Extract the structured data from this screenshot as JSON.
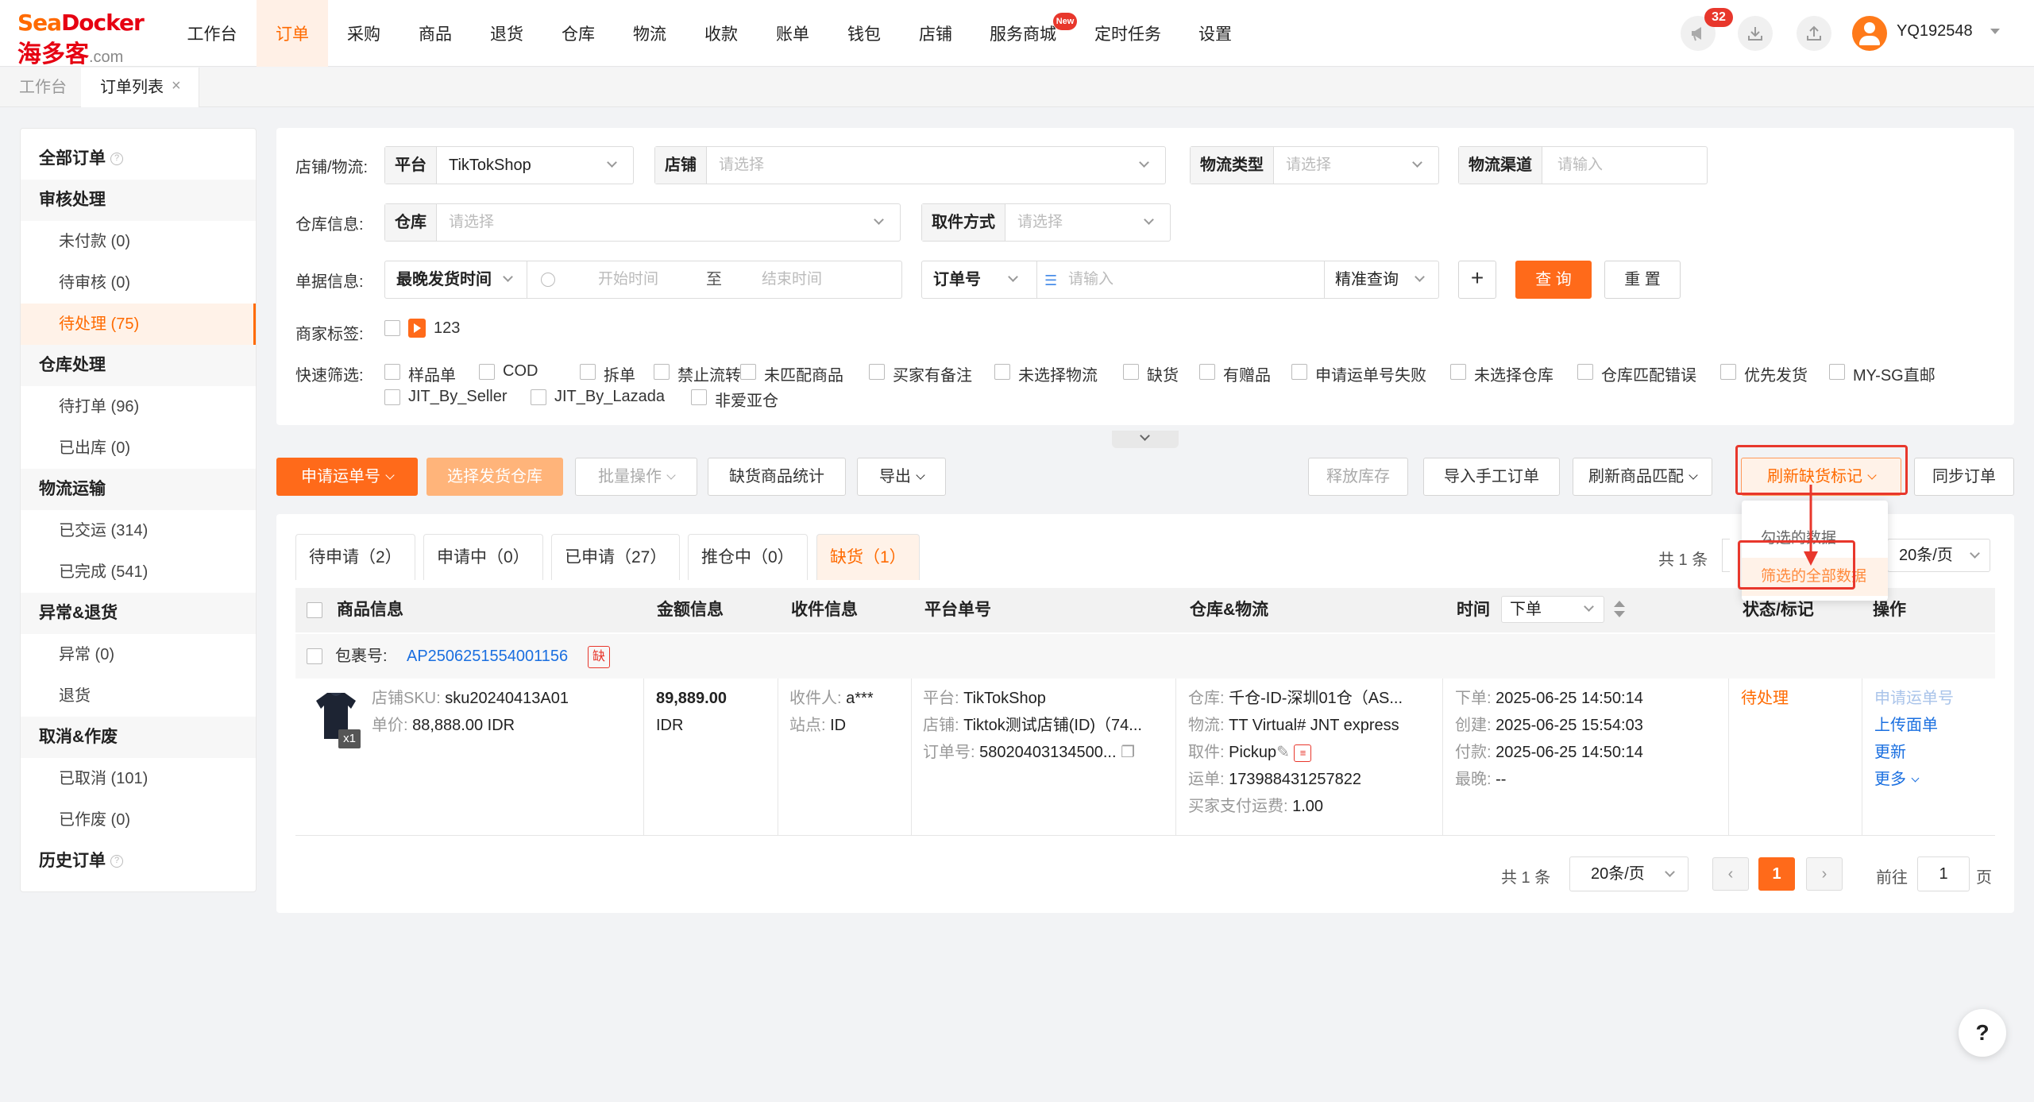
{
  "brand": {
    "name_en_a": "Sea",
    "name_en_b": "Docker",
    "name_cn": "海多客",
    "domain": ".com"
  },
  "topnav": {
    "items": [
      "工作台",
      "订单",
      "采购",
      "商品",
      "退货",
      "仓库",
      "物流",
      "收款",
      "账单",
      "钱包",
      "店铺",
      "服务商城",
      "定时任务",
      "设置"
    ],
    "active_index": 1,
    "service_badge": "New",
    "notification_count": "32",
    "username": "YQ192548"
  },
  "tabs": [
    "工作台",
    "订单列表"
  ],
  "sidebar": {
    "all_orders": "全部订单",
    "history": "历史订单",
    "groups": [
      {
        "title": "审核处理",
        "items": [
          "未付款 (0)",
          "待审核 (0)",
          "待处理 (75)"
        ]
      },
      {
        "title": "仓库处理",
        "items": [
          "待打单 (96)",
          "已出库 (0)"
        ]
      },
      {
        "title": "物流运输",
        "items": [
          "已交运 (314)",
          "已完成 (541)"
        ]
      },
      {
        "title": "异常&退货",
        "items": [
          "异常 (0)",
          "退货"
        ]
      },
      {
        "title": "取消&作废",
        "items": [
          "已取消 (101)",
          "已作废 (0)"
        ]
      }
    ]
  },
  "filter": {
    "store_logistics_label": "店铺/物流:",
    "platform_label": "平台",
    "platform_value": "TikTokShop",
    "store_label": "店铺",
    "store_ph": "请选择",
    "logistics_type_label": "物流类型",
    "logistics_type_ph": "请选择",
    "logistics_channel_label": "物流渠道",
    "logistics_channel_ph": "请输入",
    "warehouse_info_label": "仓库信息:",
    "warehouse_label": "仓库",
    "warehouse_ph": "请选择",
    "pickup_label": "取件方式",
    "pickup_ph": "请选择",
    "doc_info_label": "单据信息:",
    "time_select": "最晚发货时间",
    "start_ph": "开始时间",
    "to": "至",
    "end_ph": "结束时间",
    "order_no_select": "订单号",
    "order_no_ph": "请输入",
    "exact_select": "精准查询",
    "add": "+",
    "query": "查 询",
    "reset": "重 置",
    "merchant_tag_label": "商家标签:",
    "merchant_tag": "123",
    "quick_label": "快速筛选:",
    "quick_row1": [
      "样品单",
      "COD",
      "拆单",
      "禁止流转",
      "未匹配商品",
      "买家有备注",
      "未选择物流",
      "缺货",
      "有赠品",
      "申请运单号失败",
      "未选择仓库",
      "仓库匹配错误",
      "优先发货",
      "MY-SG直邮"
    ],
    "quick_row2": [
      "JIT_By_Seller",
      "JIT_By_Lazada",
      "非爱亚仓"
    ]
  },
  "actions": {
    "apply_waybill": "申请运单号",
    "select_warehouse": "选择发货仓库",
    "batch": "批量操作",
    "stockout_stats": "缺货商品统计",
    "export": "导出",
    "release_stock": "释放库存",
    "import_manual": "导入手工订单",
    "refresh_match": "刷新商品匹配",
    "refresh_stockout": "刷新缺货标记",
    "sync": "同步订单"
  },
  "dropdown": {
    "items": [
      "勾选的数据",
      "筛选的全部数据"
    ]
  },
  "status_tabs": [
    "待申请（2）",
    "申请中（0）",
    "已申请（27）",
    "推仓中（0）",
    "缺货（1）"
  ],
  "status_active": 4,
  "list_meta": {
    "total": "共 1 条",
    "page_size": "20条/页"
  },
  "table": {
    "headers": [
      "商品信息",
      "金额信息",
      "收件信息",
      "平台单号",
      "仓库&物流",
      "时间",
      "状态/标记",
      "操作"
    ],
    "time_select": "下单",
    "package_label": "包裹号:",
    "package_no": "AP2506251554001156",
    "package_tag": "缺",
    "row": {
      "sku_label": "店铺SKU:",
      "sku": "sku20240413A01",
      "unit_label": "单价:",
      "unit": "88,888.00 IDR",
      "qty": "x1",
      "amount": "89,889.00",
      "currency": "IDR",
      "receiver_label": "收件人:",
      "receiver": "a***",
      "site_label": "站点:",
      "site": "ID",
      "platform_label": "平台:",
      "platform": "TikTokShop",
      "store_label": "店铺:",
      "store": "Tiktok测试店铺(ID)（74...",
      "orderno_label": "订单号:",
      "orderno": "58020403134500...",
      "wh_label": "仓库:",
      "wh": "千仓-ID-深圳01仓（AS...",
      "log_label": "物流:",
      "log": "TT Virtual# JNT express",
      "pick_label": "取件:",
      "pick": "Pickup",
      "waybill_label": "运单:",
      "waybill": "173988431257822",
      "fee_label": "买家支付运费:",
      "fee": "1.00",
      "t_order_label": "下单:",
      "t_order": "2025-06-25 14:50:14",
      "t_create_label": "创建:",
      "t_create": "2025-06-25 15:54:03",
      "t_pay_label": "付款:",
      "t_pay": "2025-06-25 14:50:14",
      "t_late_label": "最晚:",
      "t_late": "--",
      "status": "待处理",
      "op_apply": "申请运单号",
      "op_upload": "上传面单",
      "op_update": "更新",
      "op_more": "更多"
    }
  },
  "pagination": {
    "total": "共 1 条",
    "page_size": "20条/页",
    "current": "1",
    "goto_label": "前往",
    "goto_value": "1",
    "page_unit": "页"
  },
  "help": "?"
}
